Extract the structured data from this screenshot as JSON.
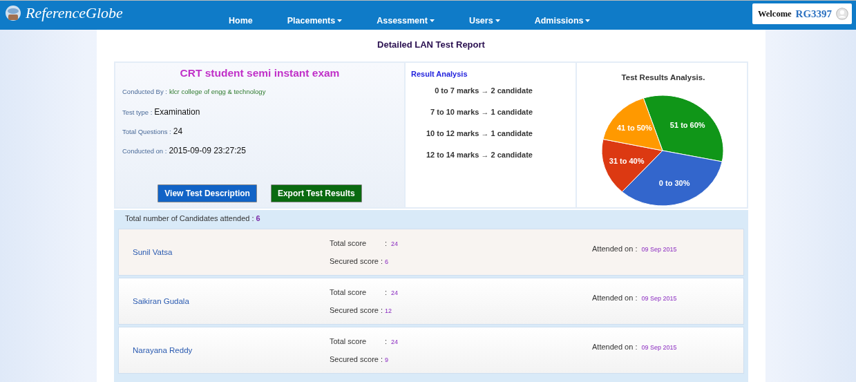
{
  "header": {
    "logo": "ReferenceGlobe",
    "nav": [
      {
        "label": "Home",
        "dropdown": false
      },
      {
        "label": "Placements",
        "dropdown": true
      },
      {
        "label": "Assessment",
        "dropdown": true
      },
      {
        "label": "Users",
        "dropdown": true
      },
      {
        "label": "Admissions",
        "dropdown": true
      }
    ],
    "welcome": "Welcome",
    "user": "RG3397"
  },
  "page_title": "Detailed LAN Test Report",
  "test": {
    "name": "CRT student semi instant exam",
    "fields": [
      {
        "label": "Conducted By :",
        "value": "klcr college of engg & technology",
        "kind": "small"
      },
      {
        "label": "Test type :",
        "value": "Examination",
        "kind": "large"
      },
      {
        "label": "Total Questions :",
        "value": "24",
        "kind": "large"
      },
      {
        "label": "Conducted on :",
        "value": "2015-09-09 23:27:25",
        "kind": "large"
      }
    ],
    "buttons": [
      {
        "label": "View Test Description",
        "kind": "primary"
      },
      {
        "label": "Export Test Results",
        "kind": "success"
      }
    ]
  },
  "result_analysis": {
    "title": "Result Analysis",
    "lines": [
      "0 to 7 marks → 2 candidate",
      "7 to 10 marks → 1 candidate",
      "10 to 12 marks → 1 candidate",
      "12 to 14 marks → 2 candidate"
    ]
  },
  "chart": {
    "chart_data": {
      "type": "pie",
      "title": "Test Results Analysis.",
      "categories": [
        "51 to 60%",
        "0 to 30%",
        "31 to 40%",
        "41 to 50%"
      ],
      "values": [
        33.3,
        33.4,
        16.7,
        16.6
      ]
    }
  },
  "candidates": {
    "label": "Total number of Candidates attended :",
    "count": "6",
    "rows": [
      {
        "name": "Sunil Vatsa",
        "total_label": "Total score",
        "total_sep": ":",
        "total": "24",
        "secured_label": "Secured score :",
        "secured": "6",
        "attended_label": "Attended on :",
        "attended": "09 Sep 2015",
        "selected": true
      },
      {
        "name": "Saikiran Gudala",
        "total_label": "Total score",
        "total_sep": ":",
        "total": "24",
        "secured_label": "Secured score :",
        "secured": "12",
        "attended_label": "Attended on :",
        "attended": "09 Sep 2015",
        "selected": false
      },
      {
        "name": "Narayana Reddy",
        "total_label": "Total score",
        "total_sep": ":",
        "total": "24",
        "secured_label": "Secured score :",
        "secured": "9",
        "attended_label": "Attended on :",
        "attended": "09 Sep 2015",
        "selected": false
      }
    ]
  }
}
